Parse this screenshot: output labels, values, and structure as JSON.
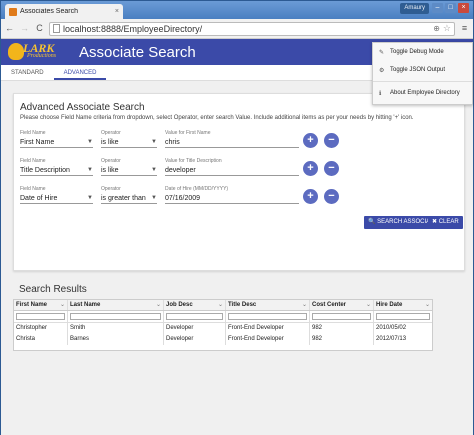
{
  "browser": {
    "tab_title": "Associates Search",
    "tab_close": "×",
    "user": "Amaury",
    "url": "localhost:8888/EmployeeDirectory/",
    "back": "←",
    "forward": "→",
    "reload": "C",
    "zoom": "⊕",
    "star": "☆",
    "menu": "≡",
    "win_min": "–",
    "win_max": "□",
    "win_close": "×"
  },
  "app": {
    "logo_brand": "LARK",
    "logo_sub": "Productions",
    "title": "Associate Search",
    "tabs": [
      "STANDARD",
      "ADVANCED"
    ]
  },
  "menu": {
    "items": [
      {
        "icon": "✎",
        "label": "Toggle Debug Mode"
      },
      {
        "icon": "⚙",
        "label": "Toggle JSON Output"
      },
      {
        "icon": "ℹ",
        "label": "About Employee Directory"
      }
    ]
  },
  "advanced": {
    "title": "Advanced Associate Search",
    "help": "Please choose Field Name criteria from dropdown, select Operator, enter search Value. Include additional items as per your needs by hitting '+' icon.",
    "rows": [
      {
        "field_label": "Field Name",
        "field": "First Name",
        "op_label": "Operator",
        "op": "is like",
        "val_label": "Value for First Name",
        "val": "chris"
      },
      {
        "field_label": "Field Name",
        "field": "Title Description",
        "op_label": "Operator",
        "op": "is like",
        "val_label": "Value for Title Description",
        "val": "developer"
      },
      {
        "field_label": "Field Name",
        "field": "Date of Hire",
        "op_label": "Operator",
        "op": "is greater than",
        "val_label": "Date of Hire (MM/DD/YYYY)",
        "val": "07/16/2009"
      }
    ],
    "plus": "+",
    "minus": "−",
    "search_btn": "SEARCH ASSOCIATE",
    "clear_btn": "CLEAR",
    "search_icon": "🔍",
    "clear_icon": "✖"
  },
  "results": {
    "title": "Search Results",
    "sort_icon": "⌄",
    "columns": [
      "First Name",
      "Last Name",
      "Job Desc",
      "Title Desc",
      "Cost Center",
      "Hire Date"
    ],
    "rows": [
      [
        "Christopher",
        "Smith",
        "Developer",
        "Front-End Developer",
        "982",
        "2010/05/02"
      ],
      [
        "Christa",
        "Barnes",
        "Developer",
        "Front-End Developer",
        "982",
        "2012/07/13"
      ]
    ]
  },
  "colors": {
    "header": "#3b4aa8",
    "accent": "#5c6bc0",
    "logo": "#f7c332"
  }
}
